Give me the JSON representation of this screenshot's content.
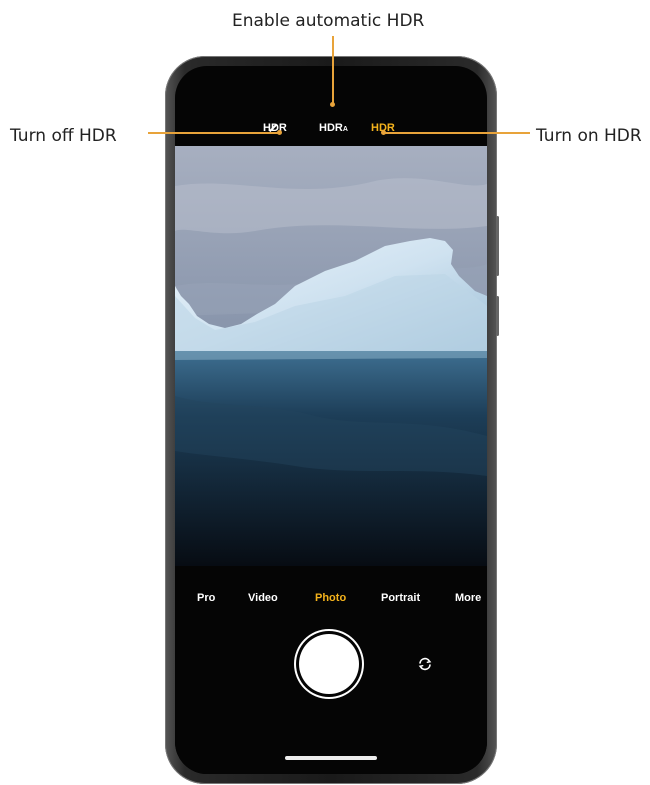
{
  "callouts": {
    "auto": "Enable automatic HDR",
    "off": "Turn off HDR",
    "on": "Turn on HDR"
  },
  "hdr_options": {
    "off_label": "HDR",
    "auto_label": "HDR",
    "auto_sub": "A",
    "on_label": "HDR"
  },
  "modes": [
    "Pro",
    "Video",
    "Photo",
    "Portrait",
    "More"
  ],
  "active_mode": "Photo",
  "colors": {
    "accent": "#f5b31c",
    "callout_line": "#e8a33a"
  }
}
